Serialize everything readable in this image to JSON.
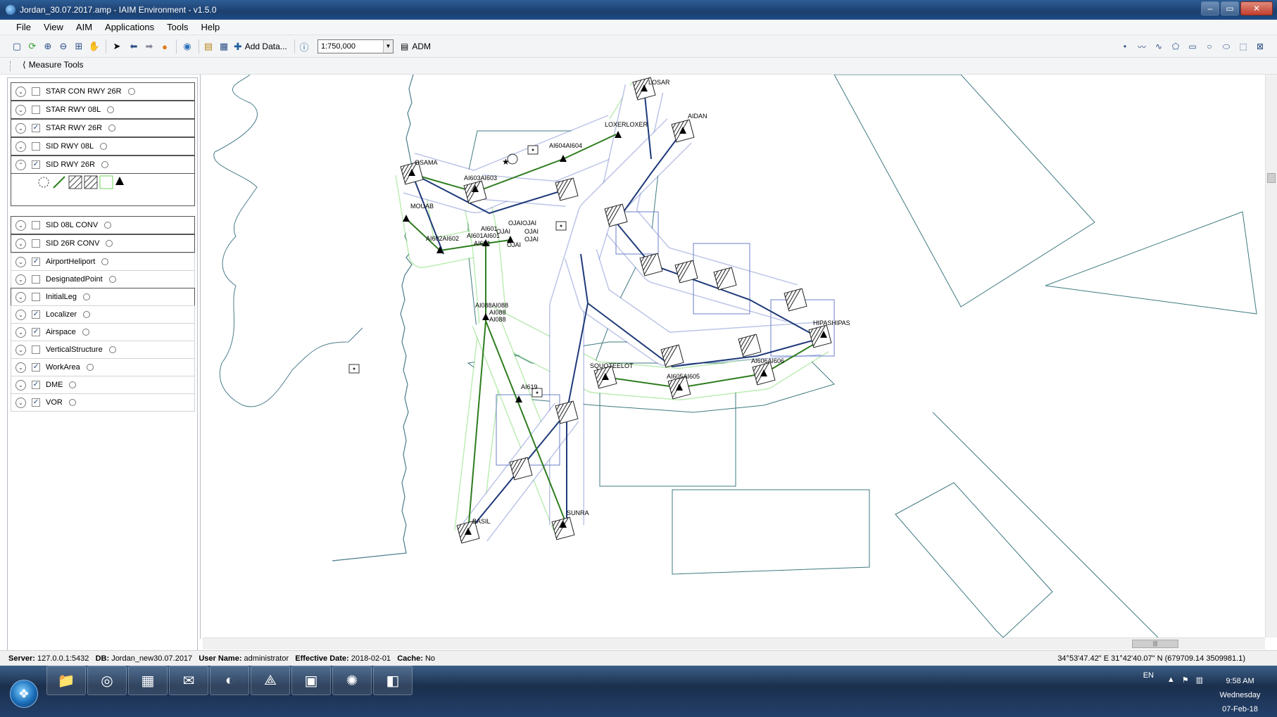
{
  "window": {
    "title": "Jordan_30.07.2017.amp - IAIM Environment - v1.5.0",
    "minimize": "–",
    "maximize": "▭",
    "close": "✕"
  },
  "menu": [
    "File",
    "View",
    "AIM",
    "Applications",
    "Tools",
    "Help"
  ],
  "toolbar": {
    "add_data": "Add Data...",
    "scale": "1:750,000",
    "adm": "ADM"
  },
  "measure_tools": "Measure Tools",
  "layers": [
    {
      "name": "STAR CON RWY 26R",
      "checked": false,
      "expanded": false,
      "border": "dark"
    },
    {
      "name": "STAR RWY 08L",
      "checked": false,
      "expanded": false,
      "border": "dark"
    },
    {
      "name": "STAR RWY 26R",
      "checked": true,
      "expanded": false,
      "border": "dark"
    },
    {
      "name": "SID RWY 08L",
      "checked": false,
      "expanded": false,
      "border": "dark"
    },
    {
      "name": "SID RWY 26R",
      "checked": true,
      "expanded": true,
      "border": "dark"
    },
    {
      "name": "SID 08L CONV",
      "checked": false,
      "expanded": false,
      "border": "dark"
    },
    {
      "name": "SID 26R CONV",
      "checked": false,
      "expanded": false,
      "border": "dark"
    },
    {
      "name": "AirportHeliport",
      "checked": true,
      "expanded": false,
      "border": "light"
    },
    {
      "name": "DesignatedPoint",
      "checked": false,
      "expanded": false,
      "border": "light"
    },
    {
      "name": "InitialLeg",
      "checked": false,
      "expanded": false,
      "border": "dark"
    },
    {
      "name": "Localizer",
      "checked": true,
      "expanded": false,
      "border": "light"
    },
    {
      "name": "Airspace",
      "checked": true,
      "expanded": false,
      "border": "light"
    },
    {
      "name": "VerticalStructure",
      "checked": false,
      "expanded": false,
      "border": "light"
    },
    {
      "name": "WorkArea",
      "checked": true,
      "expanded": false,
      "border": "light"
    },
    {
      "name": "DME",
      "checked": true,
      "expanded": false,
      "border": "light"
    },
    {
      "name": "VOR",
      "checked": true,
      "expanded": false,
      "border": "light"
    }
  ],
  "map_labels": [
    {
      "id": "losar",
      "text": "LOSAR"
    },
    {
      "id": "aidan",
      "text": "AIDAN"
    },
    {
      "id": "loxer",
      "text": "LOXERLOXER"
    },
    {
      "id": "ai604",
      "text": "AI604AI604"
    },
    {
      "id": "osama",
      "text": "OSAMA"
    },
    {
      "id": "ai603",
      "text": "AI603AI603"
    },
    {
      "id": "mouab",
      "text": "MOUAB"
    },
    {
      "id": "ai602",
      "text": "AI602AI602"
    },
    {
      "id": "ai601a",
      "text": "AI601"
    },
    {
      "id": "ai601b",
      "text": "AI601AI601"
    },
    {
      "id": "ai601c",
      "text": "AI601"
    },
    {
      "id": "ojai1",
      "text": "OJAIOJAI"
    },
    {
      "id": "ojai2",
      "text": "OJAI"
    },
    {
      "id": "ojai3",
      "text": "OJAI"
    },
    {
      "id": "ojai4",
      "text": "OJAI"
    },
    {
      "id": "ojai5",
      "text": "OJAI"
    },
    {
      "id": "ai088a",
      "text": "AI088AI088"
    },
    {
      "id": "ai088b",
      "text": "AI088"
    },
    {
      "id": "ai088c",
      "text": "AI088"
    },
    {
      "id": "hipas",
      "text": "HIPASHIPAS"
    },
    {
      "id": "elot",
      "text": "SQUOTEELOT"
    },
    {
      "id": "ai605",
      "text": "AI605AI605"
    },
    {
      "id": "ai606",
      "text": "AI606AI606"
    },
    {
      "id": "ai619",
      "text": "AI619"
    },
    {
      "id": "sunra",
      "text": "SUNRA"
    },
    {
      "id": "basil",
      "text": "BASIL"
    }
  ],
  "status": {
    "server_label": "Server:",
    "server": "127.0.0.1:5432",
    "db_label": "DB:",
    "db": "Jordan_new30.07.2017",
    "user_label": "User Name:",
    "user": "administrator",
    "date_label": "Effective Date:",
    "date": "2018-02-01",
    "cache_label": "Cache:",
    "cache": "No",
    "coords": "34°53'47.42\" E  31°42'40.07\" N  (679709.14  3509981.1)"
  },
  "taskbar": {
    "lang": "EN",
    "time": "9:58 AM",
    "day": "Wednesday",
    "date": "07-Feb-18"
  },
  "colors": {
    "route_dark": "#1f3a7a",
    "route_green": "#2e7d1e",
    "buffer_green": "#6fd45a",
    "buffer_blue": "#6b7fc9",
    "area_teal": "#3f7a80",
    "coast": "#4a7d8a"
  }
}
